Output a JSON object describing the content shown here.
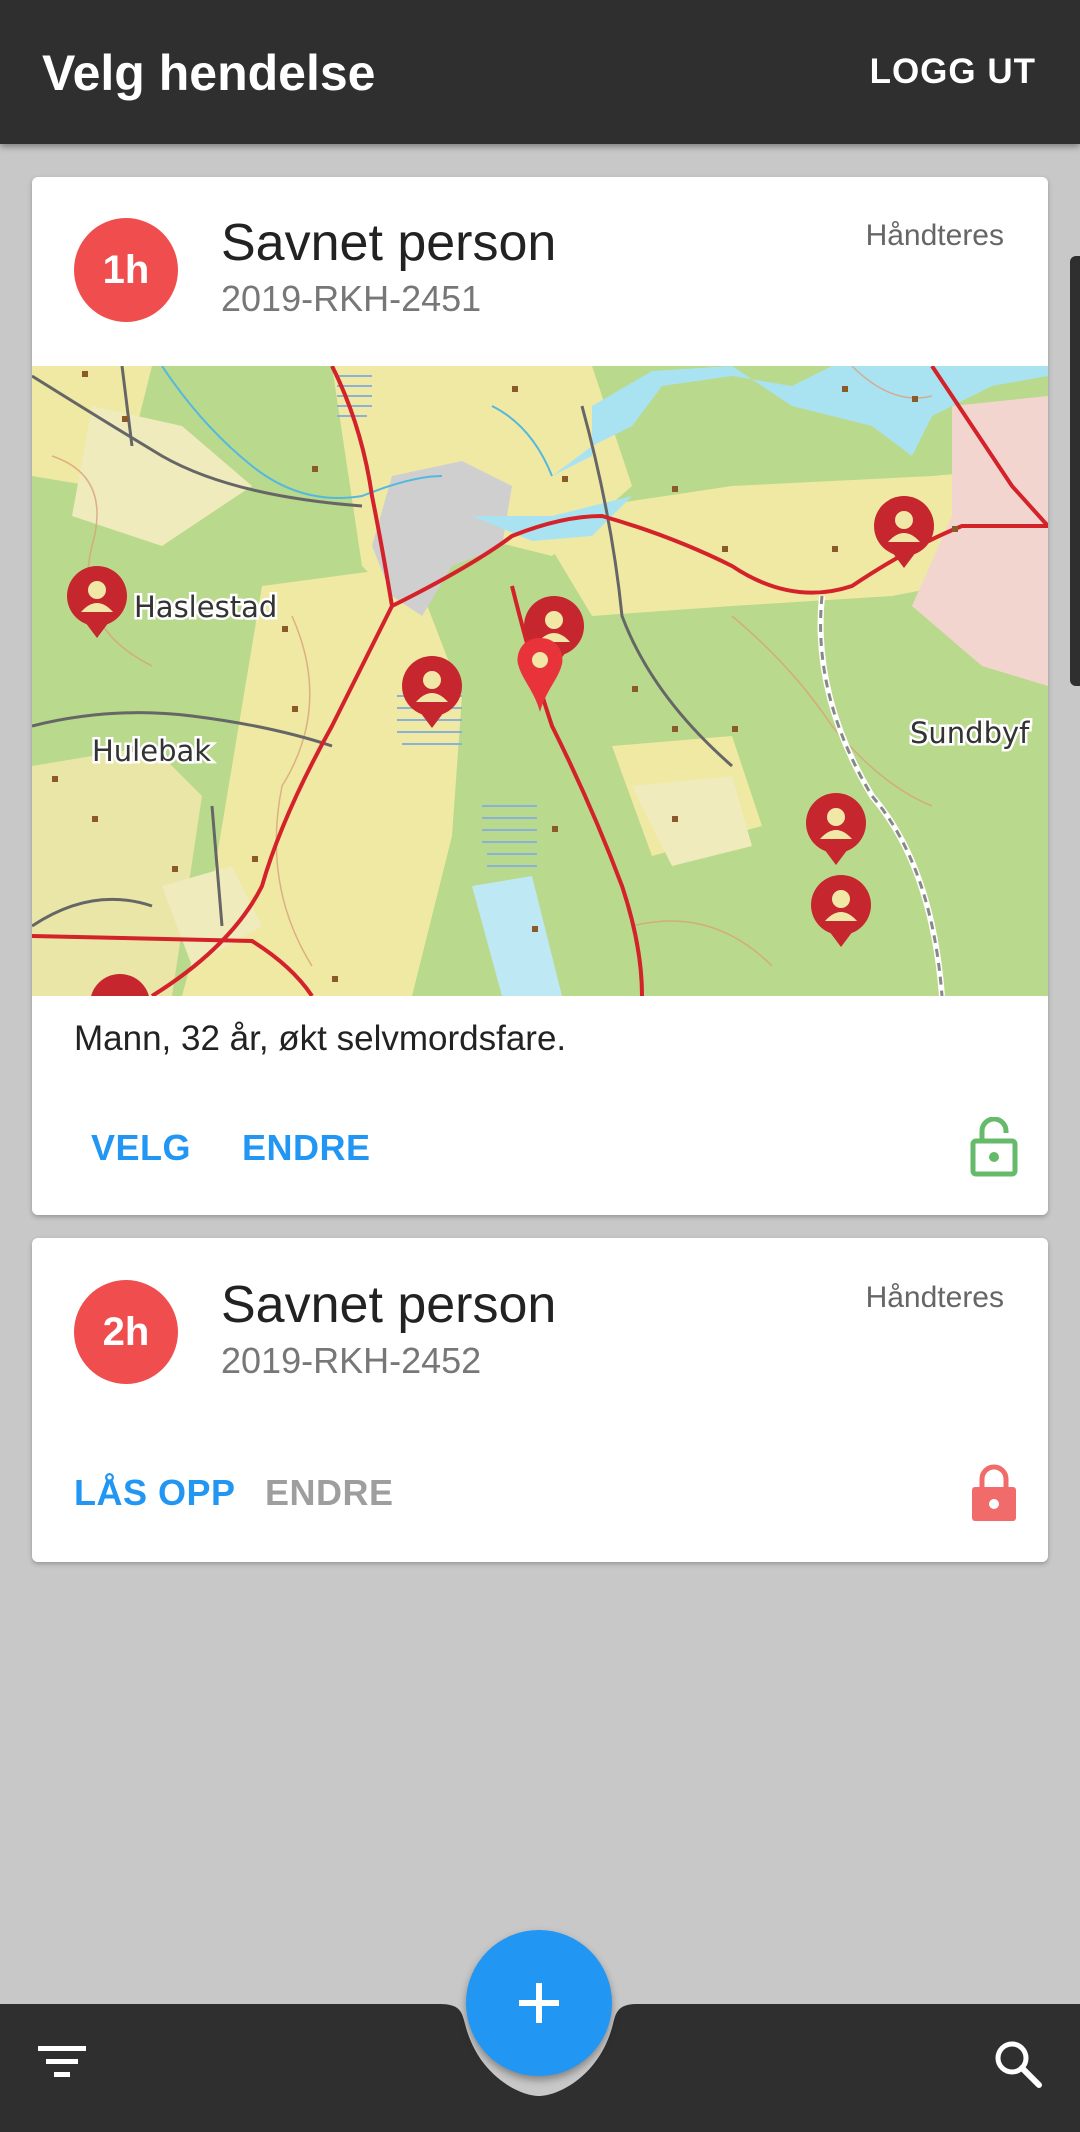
{
  "appbar": {
    "title": "Velg hendelse",
    "logout_label": "LOGG UT"
  },
  "incidents": [
    {
      "badge": "1h",
      "title": "Savnet person",
      "reference": "2019-RKH-2451",
      "status": "Håndteres",
      "description": "Mann, 32 år, økt selvmordsfare.",
      "actions": {
        "primary": "VELG",
        "secondary": "ENDRE"
      },
      "lock_state": "unlocked",
      "lock_color": "#66bb6a",
      "map": {
        "place_labels": [
          "Haslestad",
          "Hulebak",
          "Sundbyf"
        ],
        "marker_icons": [
          "person-marker-icon",
          "location-pin-icon"
        ]
      }
    },
    {
      "badge": "2h",
      "title": "Savnet person",
      "reference": "2019-RKH-2452",
      "status": "Håndteres",
      "actions": {
        "primary": "LÅS OPP",
        "secondary": "ENDRE"
      },
      "lock_state": "locked",
      "lock_color": "#f26b6b"
    }
  ],
  "colors": {
    "accent": "#2196f3",
    "badge": "#f04e4e",
    "appbar": "#2f2f2f"
  },
  "bottombar": {
    "icons": [
      "filter-icon",
      "add-icon",
      "search-icon"
    ]
  }
}
